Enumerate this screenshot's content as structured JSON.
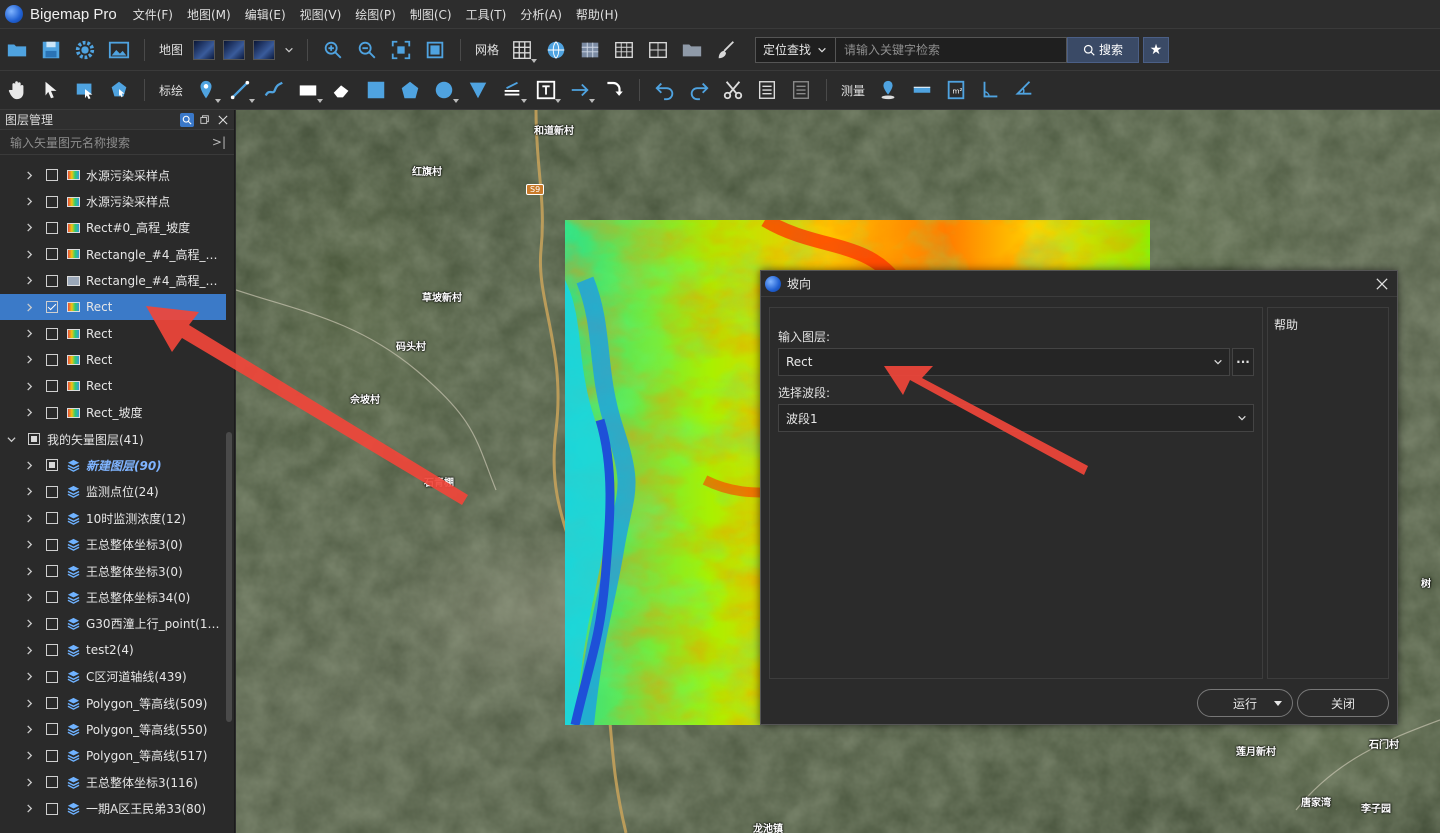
{
  "app": {
    "name": "Bigemap Pro"
  },
  "menu": [
    "文件(F)",
    "地图(M)",
    "编辑(E)",
    "视图(V)",
    "绘图(P)",
    "制图(C)",
    "工具(T)",
    "分析(A)",
    "帮助(H)"
  ],
  "toolbar1": {
    "map_label": "地图",
    "grid_label": "网格",
    "locate_mode": "定位查找",
    "search_placeholder": "请输入关键字检索",
    "search_button": "搜索"
  },
  "toolbar2": {
    "mark_label": "标绘",
    "measure_label": "测量"
  },
  "layer_panel": {
    "title": "图层管理",
    "search_placeholder": "输入矢量图元名称搜索",
    "rows": [
      {
        "label": "水源污染采样点",
        "kind": "raster",
        "indent": 1,
        "check": "none"
      },
      {
        "label": "水源污染采样点",
        "kind": "raster",
        "indent": 1,
        "check": "none"
      },
      {
        "label": "Rect#0_高程_坡度",
        "kind": "raster",
        "indent": 1,
        "check": "none"
      },
      {
        "label": "Rectangle_#4_高程_Le...",
        "kind": "raster",
        "indent": 1,
        "check": "none"
      },
      {
        "label": "Rectangle_#4_高程_Le...",
        "kind": "gray",
        "indent": 1,
        "check": "none"
      },
      {
        "label": "Rect",
        "kind": "raster",
        "indent": 1,
        "check": "checked",
        "selected": true
      },
      {
        "label": "Rect",
        "kind": "raster",
        "indent": 1,
        "check": "none"
      },
      {
        "label": "Rect",
        "kind": "raster",
        "indent": 1,
        "check": "none"
      },
      {
        "label": "Rect",
        "kind": "raster",
        "indent": 1,
        "check": "none"
      },
      {
        "label": "Rect_坡度",
        "kind": "raster",
        "indent": 1,
        "check": "none"
      },
      {
        "label": "我的矢量图层(41)",
        "kind": "group",
        "indent": 0,
        "check": "partial",
        "expanded": true
      },
      {
        "label": "新建图层(90)",
        "kind": "vector",
        "indent": 1,
        "check": "partial",
        "italic": true
      },
      {
        "label": "监测点位(24)",
        "kind": "vector",
        "indent": 1,
        "check": "none"
      },
      {
        "label": "10时监测浓度(12)",
        "kind": "vector",
        "indent": 1,
        "check": "none"
      },
      {
        "label": "王总整体坐标3(0)",
        "kind": "vector",
        "indent": 1,
        "check": "none"
      },
      {
        "label": "王总整体坐标3(0)",
        "kind": "vector",
        "indent": 1,
        "check": "none"
      },
      {
        "label": "王总整体坐标34(0)",
        "kind": "vector",
        "indent": 1,
        "check": "none"
      },
      {
        "label": "G30西潼上行_point(13...",
        "kind": "vector",
        "indent": 1,
        "check": "none"
      },
      {
        "label": "test2(4)",
        "kind": "vector",
        "indent": 1,
        "check": "none"
      },
      {
        "label": "C区河道轴线(439)",
        "kind": "vector",
        "indent": 1,
        "check": "none"
      },
      {
        "label": "Polygon_等高线(509)",
        "kind": "vector",
        "indent": 1,
        "check": "none"
      },
      {
        "label": "Polygon_等高线(550)",
        "kind": "vector",
        "indent": 1,
        "check": "none"
      },
      {
        "label": "Polygon_等高线(517)",
        "kind": "vector",
        "indent": 1,
        "check": "none"
      },
      {
        "label": "王总整体坐标3(116)",
        "kind": "vector",
        "indent": 1,
        "check": "none"
      },
      {
        "label": "一期A区王民弟33(80)",
        "kind": "vector",
        "indent": 1,
        "check": "none"
      }
    ]
  },
  "map": {
    "places": [
      "和道新村",
      "红旗村",
      "草坡新村",
      "码头村",
      "佘坡村",
      "石青棚",
      "莲月新村",
      "石门村",
      "唐家湾",
      "李子园",
      "龙池镇",
      "树"
    ],
    "road_badge": "S9"
  },
  "dialog": {
    "title": "坡向",
    "input_layer_label": "输入图层:",
    "input_layer_value": "Rect",
    "more_label": "···",
    "band_label": "选择波段:",
    "band_value": "波段1",
    "help_label": "帮助",
    "run_label": "运行",
    "close_label": "关闭"
  }
}
